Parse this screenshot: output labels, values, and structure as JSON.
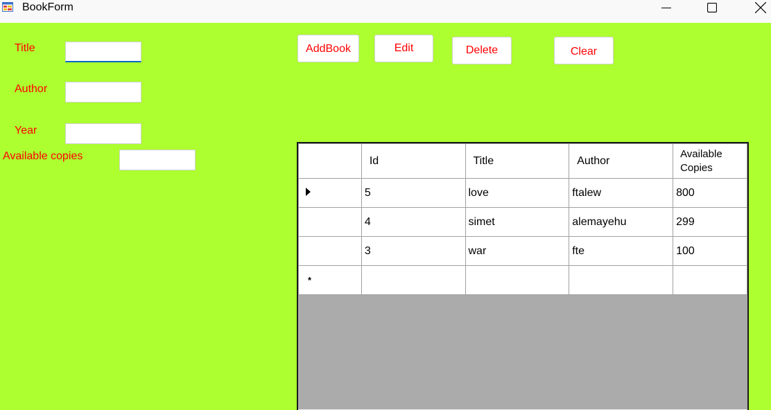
{
  "window": {
    "title": "BookForm",
    "icon": "form-icon",
    "controls": [
      "minimize-icon",
      "maximize-icon",
      "close-icon"
    ]
  },
  "colors": {
    "background": "#adff2f",
    "label_text": "#ff0000",
    "grid_empty_area": "#ababab",
    "focus_underline": "#0067c0"
  },
  "form": {
    "title_label": "Title",
    "author_label": "Author",
    "year_label": "Year",
    "copies_label": "Available copies",
    "title_value": "",
    "author_value": "",
    "year_value": "",
    "copies_value": ""
  },
  "buttons": {
    "add": "AddBook",
    "edit": "Edit",
    "delete": "Delete",
    "clear": "Clear"
  },
  "grid": {
    "columns": [
      "Id",
      "Title",
      "Author",
      "Available Copies"
    ],
    "rows": [
      {
        "id": "5",
        "title": "love",
        "author": "ftalew",
        "copies": "800"
      },
      {
        "id": "4",
        "title": "simet",
        "author": "alemayehu",
        "copies": "299"
      },
      {
        "id": "3",
        "title": "war",
        "author": "fte",
        "copies": "100"
      }
    ],
    "current_row_marker": "▶",
    "new_row_marker": "*"
  }
}
